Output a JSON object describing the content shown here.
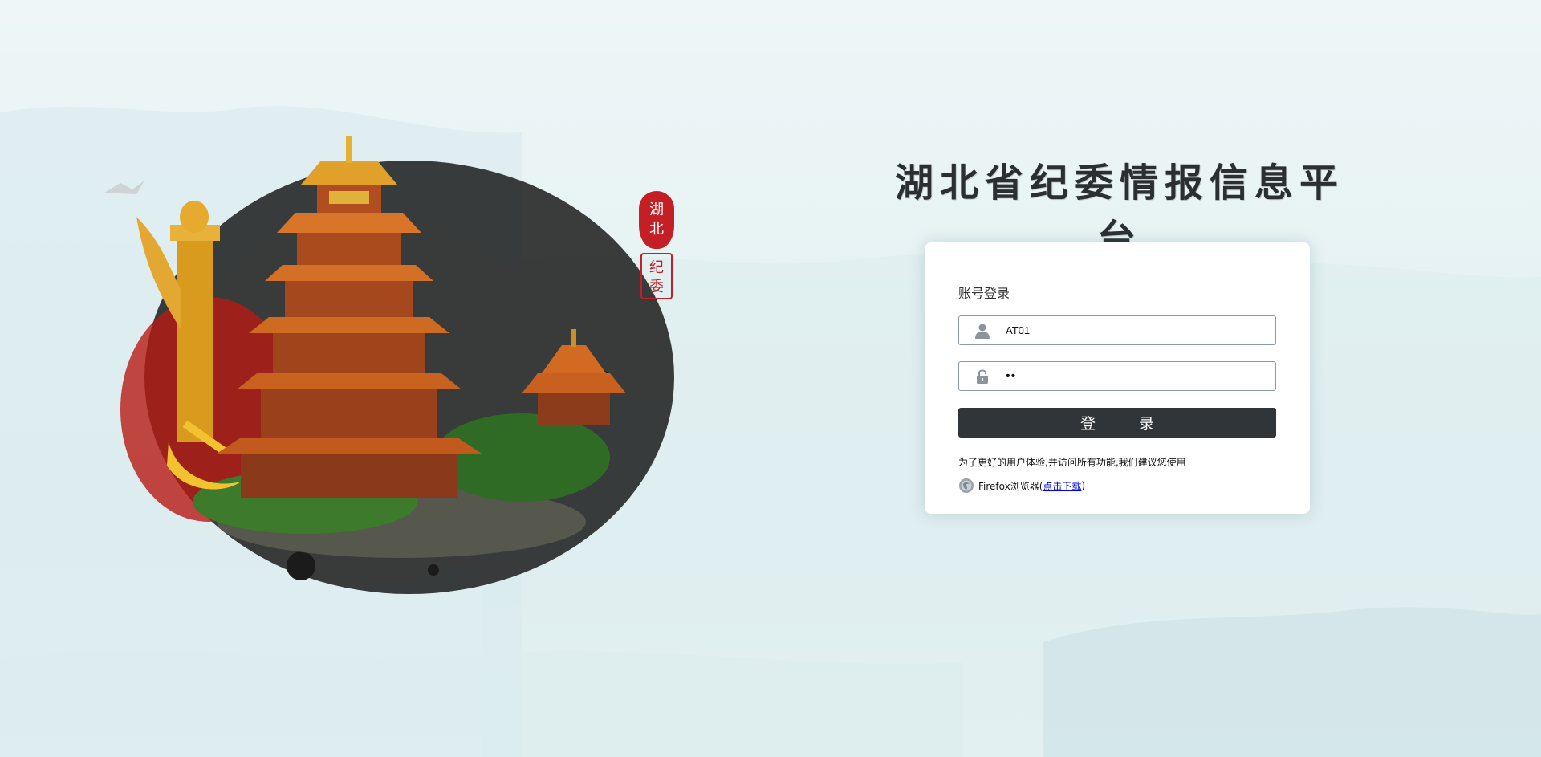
{
  "title": "湖北省纪委情报信息平台",
  "seal": {
    "line1": "湖北",
    "line2": "纪委"
  },
  "login": {
    "heading": "账号登录",
    "username_value": "AT01",
    "password_value": "••",
    "submit_label": "登 录",
    "tip": "为了更好的用户体验,并访问所有功能,我们建议您使用",
    "browser_name": "Firefox浏览器(",
    "download_link": "点击下载",
    "browser_suffix": ")"
  },
  "icons": {
    "user": "user-icon",
    "lock": "lock-icon",
    "browser": "firefox-icon"
  },
  "colors": {
    "button": "#2f3538",
    "seal_red": "#c41f24",
    "title": "#2b2f31"
  }
}
